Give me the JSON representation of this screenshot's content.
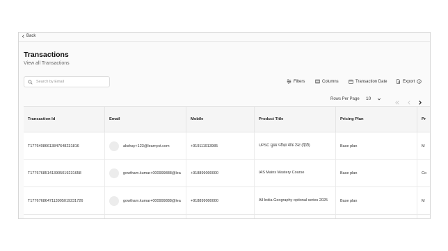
{
  "nav": {
    "back_label": "Back"
  },
  "header": {
    "title": "Transactions",
    "subtitle": "View all Transactions"
  },
  "search": {
    "placeholder": "Search by Email"
  },
  "toolbar": {
    "filters_label": "Filters",
    "columns_label": "Columns",
    "date_label": "Transaction Date",
    "export_label": "Export"
  },
  "pagination": {
    "rows_per_page_label": "Rows Per Page",
    "rows_per_page_value": "10"
  },
  "table": {
    "columns": [
      "Transaction Id",
      "Email",
      "Mobile",
      "Product Title",
      "Pricing Plan",
      "Pr"
    ],
    "rows": [
      {
        "transaction_id": "T17764086613847648231816",
        "email": "akshay+123@learnyst.com",
        "mobile": "+919111913985",
        "product_title": "UPSC मुख्य परीक्षा मॉक टेस्ट (हिंदी)",
        "pricing_plan": "Base plan",
        "extra": "M"
      },
      {
        "transaction_id": "T17767685141390501923165​8",
        "email": "gowtham.kumar+000999888@lea",
        "mobile": "+918899000000",
        "product_title": "IAS Mains Mastery Course",
        "pricing_plan": "Base plan",
        "extra": "Co"
      },
      {
        "transaction_id": "T17767686471139050192317​26",
        "email": "gowtham.kumar+000999888@lea",
        "mobile": "+918899000000",
        "product_title": "All India Geography optional series 2025",
        "pricing_plan": "Base plan",
        "extra": "M"
      }
    ]
  }
}
